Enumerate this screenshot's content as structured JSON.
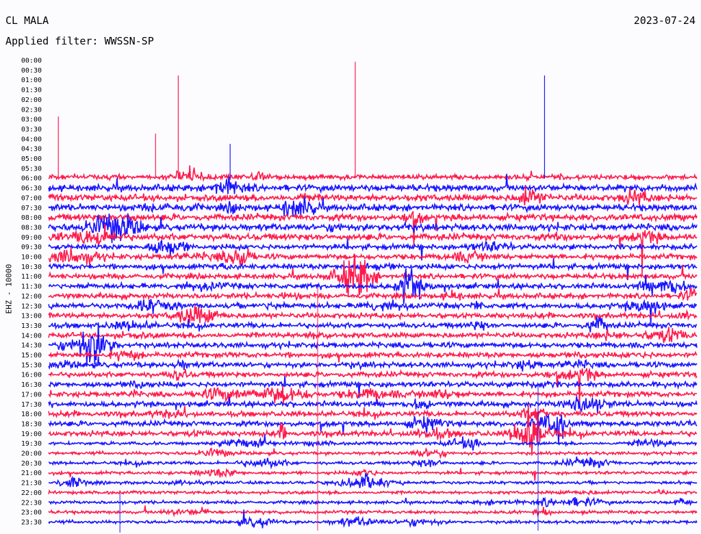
{
  "header": {
    "station": "CL MALA",
    "date": "2023-07-24",
    "filter_text": "Applied filter: WWSSN-SP"
  },
  "channel_label": "EHZ - 10000",
  "colors": {
    "even_row": "#ff1a4b",
    "odd_row": "#1a14ff",
    "background": "#fcfcff"
  },
  "chart_data": {
    "type": "line",
    "xlabel": "",
    "ylabel": "EHZ - 10000",
    "rows": [
      "00:00",
      "00:30",
      "01:00",
      "01:30",
      "02:00",
      "02:30",
      "03:00",
      "03:30",
      "04:00",
      "04:30",
      "05:00",
      "05:30",
      "06:00",
      "06:30",
      "07:00",
      "07:30",
      "08:00",
      "08:30",
      "09:00",
      "09:30",
      "10:00",
      "10:30",
      "11:00",
      "11:30",
      "12:00",
      "12:30",
      "13:00",
      "13:30",
      "14:00",
      "14:30",
      "15:00",
      "15:30",
      "16:00",
      "16:30",
      "17:00",
      "17:30",
      "18:00",
      "18:30",
      "19:00",
      "19:30",
      "20:00",
      "20:30",
      "21:00",
      "21:30",
      "22:00",
      "22:30",
      "23:00",
      "23:30"
    ],
    "first_trace_row": "06:00",
    "grid": false,
    "legend": "none"
  }
}
